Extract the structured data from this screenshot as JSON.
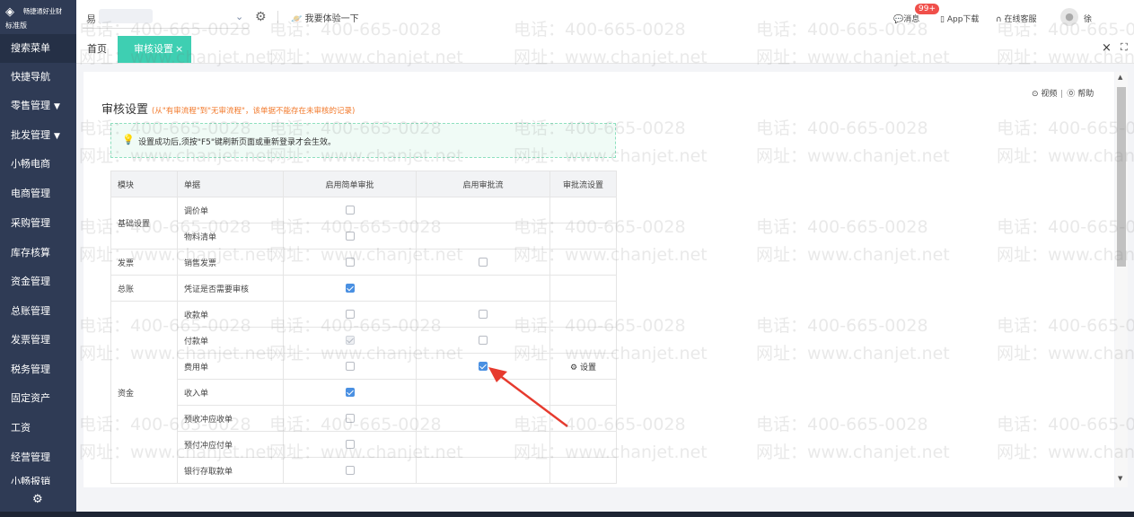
{
  "brand": {
    "logo_glyph": "◈",
    "name": "畅捷通好业财",
    "edition": "标准版"
  },
  "account": {
    "name": "易",
    "chevron": "⌄"
  },
  "topbar": {
    "gear_glyph": "⚙",
    "trial_label": "我要体验一下",
    "message_label": "消息",
    "message_badge": "99+",
    "app_download_label": "App下载",
    "support_label": "在线客服",
    "user_name": "徐"
  },
  "sidebar": {
    "items": [
      {
        "label": "搜索菜单"
      },
      {
        "label": "快捷导航"
      },
      {
        "label": "零售管理",
        "caret": "▼"
      },
      {
        "label": "批发管理",
        "caret": "▼"
      },
      {
        "label": "小畅电商"
      },
      {
        "label": "电商管理"
      },
      {
        "label": "采购管理"
      },
      {
        "label": "库存核算"
      },
      {
        "label": "资金管理"
      },
      {
        "label": "总账管理"
      },
      {
        "label": "发票管理"
      },
      {
        "label": "税务管理"
      },
      {
        "label": "固定资产"
      },
      {
        "label": "工资"
      },
      {
        "label": "经营管理"
      },
      {
        "label": "小畅报销"
      }
    ],
    "settings_glyph": "⚙"
  },
  "tabs": {
    "home": "首页",
    "active": "审核设置",
    "active_close": "×",
    "close_all": "×",
    "fullscreen": "⛶"
  },
  "page": {
    "video_link": "⊙ 视频",
    "help_link": "⓪ 帮助",
    "title": "审核设置",
    "title_hint": "(从\"有审流程\"到\"无审流程\"，该单据不能存在未审核的记录)",
    "notice": "设置成功后,须按\"F5\"键刷新页面或重新登录才会生效。"
  },
  "table": {
    "headers": [
      "模块",
      "单据",
      "启用简单审批",
      "启用审批流",
      "审批流设置"
    ],
    "groups": [
      {
        "module": "基础设置",
        "rows": [
          {
            "doc": "调价单",
            "simple": "off",
            "flow": "none",
            "setting": ""
          },
          {
            "doc": "物料清单",
            "simple": "off",
            "flow": "none",
            "setting": ""
          }
        ]
      },
      {
        "module": "发票",
        "rows": [
          {
            "doc": "销售发票",
            "simple": "off",
            "flow": "off",
            "setting": ""
          }
        ]
      },
      {
        "module": "总账",
        "rows": [
          {
            "doc": "凭证是否需要审核",
            "simple": "on",
            "flow": "none",
            "setting": ""
          }
        ]
      },
      {
        "module": "资金",
        "rows": [
          {
            "doc": "收款单",
            "simple": "off",
            "flow": "off",
            "setting": ""
          },
          {
            "doc": "付款单",
            "simple": "disabled",
            "flow": "off",
            "setting": ""
          },
          {
            "doc": "费用单",
            "simple": "off",
            "flow": "on",
            "setting": "⚙ 设置"
          },
          {
            "doc": "收入单",
            "simple": "on",
            "flow": "none",
            "setting": ""
          },
          {
            "doc": "预收冲应收单",
            "simple": "off",
            "flow": "none",
            "setting": ""
          },
          {
            "doc": "预付冲应付单",
            "simple": "off",
            "flow": "none",
            "setting": ""
          },
          {
            "doc": "银行存取款单",
            "simple": "off",
            "flow": "none",
            "setting": ""
          }
        ]
      }
    ]
  },
  "watermark": {
    "phone": "电话：400-665-0028",
    "site": "网址：www.chanjet.net"
  },
  "colors": {
    "sidebar": "#2f3b55",
    "tab_active": "#3ecfb2",
    "checkbox_on": "#4a90e2",
    "hint": "#f2792b",
    "arrow": "#e63a2e",
    "badge": "#f04f4a"
  }
}
